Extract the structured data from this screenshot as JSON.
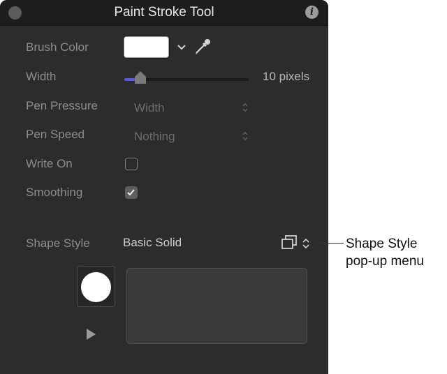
{
  "window": {
    "title": "Paint Stroke Tool"
  },
  "rows": {
    "brush_color": {
      "label": "Brush Color"
    },
    "width": {
      "label": "Width",
      "value": "10 pixels",
      "level": 0.13
    },
    "pen_pressure": {
      "label": "Pen Pressure",
      "value": "Width"
    },
    "pen_speed": {
      "label": "Pen Speed",
      "value": "Nothing"
    },
    "write_on": {
      "label": "Write On",
      "checked": false
    },
    "smoothing": {
      "label": "Smoothing",
      "checked": true
    },
    "shape_style": {
      "label": "Shape Style",
      "value": "Basic Solid"
    }
  },
  "colors": {
    "brush": "#ffffff",
    "accent": "#5a57e0",
    "panel": "#2c2c2c"
  },
  "icons": [
    "info-icon",
    "eyedropper-icon",
    "chevron-down-icon",
    "shape-library-icon",
    "play-icon"
  ],
  "callout": {
    "line1": "Shape Style",
    "line2": "pop-up menu"
  }
}
